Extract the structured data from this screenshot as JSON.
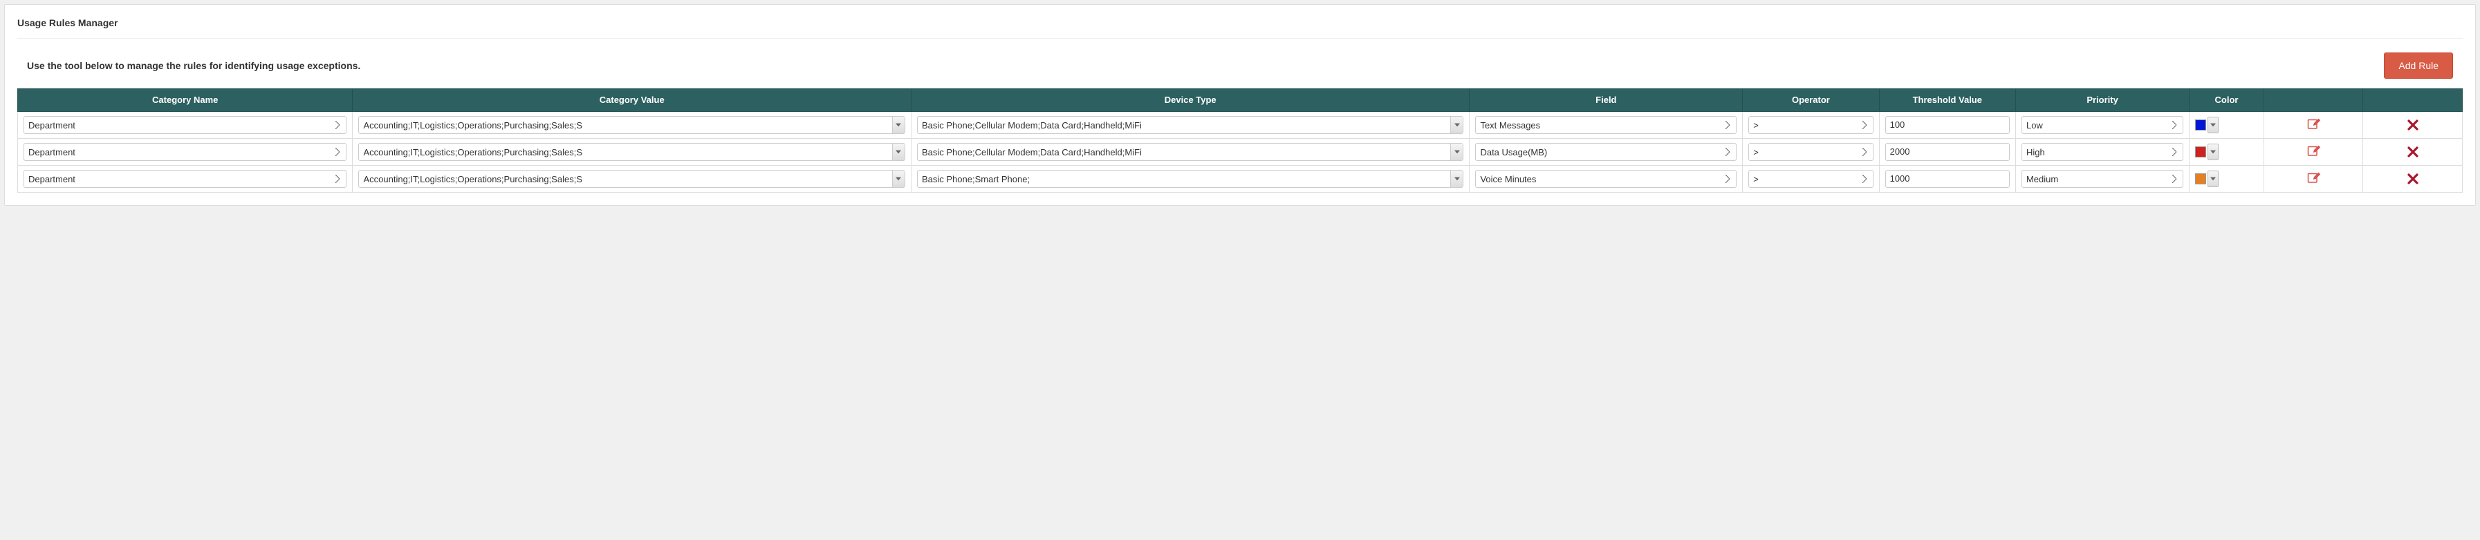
{
  "panel": {
    "title": "Usage Rules Manager",
    "instruction": "Use the tool below to manage the rules for identifying usage exceptions.",
    "add_button": "Add Rule"
  },
  "columns": {
    "category_name": "Category Name",
    "category_value": "Category Value",
    "device_type": "Device Type",
    "field": "Field",
    "operator": "Operator",
    "threshold": "Threshold Value",
    "priority": "Priority",
    "color": "Color",
    "edit": "",
    "delete": ""
  },
  "rows": [
    {
      "category_name": "Department",
      "category_value": "Accounting;IT;Logistics;Operations;Purchasing;Sales;S",
      "device_type": "Basic Phone;Cellular Modem;Data Card;Handheld;MiFi",
      "field": "Text Messages",
      "operator": ">",
      "threshold": "100",
      "priority": "Low",
      "color": "#0018d6"
    },
    {
      "category_name": "Department",
      "category_value": "Accounting;IT;Logistics;Operations;Purchasing;Sales;S",
      "device_type": "Basic Phone;Cellular Modem;Data Card;Handheld;MiFi",
      "field": "Data Usage(MB)",
      "operator": ">",
      "threshold": "2000",
      "priority": "High",
      "color": "#d02020"
    },
    {
      "category_name": "Department",
      "category_value": "Accounting;IT;Logistics;Operations;Purchasing;Sales;S",
      "device_type": "Basic Phone;Smart Phone;",
      "field": "Voice Minutes",
      "operator": ">",
      "threshold": "1000",
      "priority": "Medium",
      "color": "#e67e22"
    }
  ]
}
